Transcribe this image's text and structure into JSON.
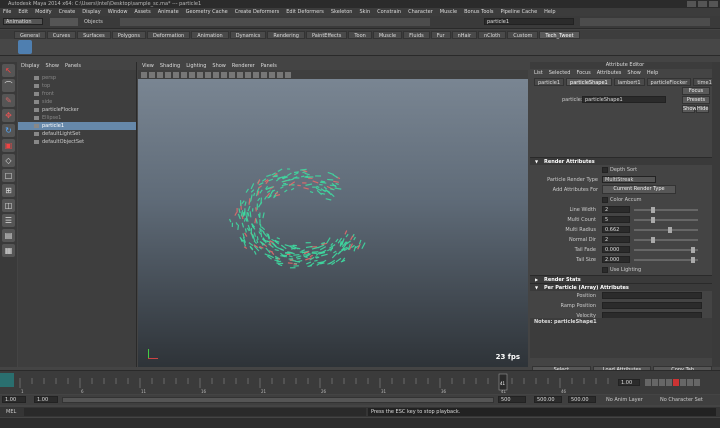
{
  "window": {
    "title": "Autodesk Maya 2014 x64: C:\\Users\\Intel\\Desktop\\sample_sc.ma* --- particle1"
  },
  "menubar": [
    "File",
    "Edit",
    "Modify",
    "Create",
    "Display",
    "Window",
    "Assets",
    "Animate",
    "Geometry Cache",
    "Create Deformers",
    "Edit Deformers",
    "Skeleton",
    "Skin",
    "Constrain",
    "Character",
    "Muscle",
    "Bonus Tools",
    "Pipeline Cache",
    "Help"
  ],
  "status": {
    "mode": "Animation",
    "objects": "Objects",
    "search": "particle1"
  },
  "shelf_tabs": [
    "General",
    "Curves",
    "Surfaces",
    "Polygons",
    "Deformation",
    "Animation",
    "Dynamics",
    "Rendering",
    "PaintEffects",
    "Toon",
    "Muscle",
    "Fluids",
    "Fur",
    "nHair",
    "nCloth",
    "Custom",
    "Tech_Tweet"
  ],
  "shelf_active": "Tech_Tweet",
  "outliner": {
    "menu": [
      "Display",
      "Show",
      "Panels"
    ],
    "items": [
      {
        "label": "persp",
        "state": "dim"
      },
      {
        "label": "top",
        "state": "dim"
      },
      {
        "label": "front",
        "state": "dim"
      },
      {
        "label": "side",
        "state": "dim"
      },
      {
        "label": "particleFlocker",
        "state": "normal"
      },
      {
        "label": "Ellipse1",
        "state": "dim"
      },
      {
        "label": "particle1",
        "state": "selected"
      },
      {
        "label": "defaultLightSet",
        "state": "normal"
      },
      {
        "label": "defaultObjectSet",
        "state": "normal"
      }
    ]
  },
  "viewport": {
    "menu": [
      "View",
      "Shading",
      "Lighting",
      "Show",
      "Renderer",
      "Panels"
    ],
    "fps": "23 fps"
  },
  "attribute_editor": {
    "title": "Attribute Editor",
    "menu": [
      "List",
      "Selected",
      "Focus",
      "Attributes",
      "Show",
      "Help"
    ],
    "tabs": [
      "particle1",
      "particleShape1",
      "lambert1",
      "particleFlocker",
      "time1"
    ],
    "active_tab": "particleShape1",
    "node_label": "particle:",
    "node_value": "particleShape1",
    "buttons": [
      "Focus",
      "Presets",
      "Show",
      "Hide"
    ],
    "render_attributes": {
      "header": "Render Attributes",
      "depth_sort": "Depth Sort",
      "render_type_label": "Particle Render Type",
      "render_type_value": "MultiStreak",
      "add_attr_label": "Add Attributes For",
      "add_attr_button": "Current Render Type",
      "color_accum": "Color Accum",
      "line_width": {
        "label": "Line Width",
        "value": "2"
      },
      "multi_count": {
        "label": "Multi Count",
        "value": "5"
      },
      "multi_radius": {
        "label": "Multi Radius",
        "value": "0.662"
      },
      "normal_dir": {
        "label": "Normal Dir",
        "value": "2"
      },
      "tail_fade": {
        "label": "Tail Fade",
        "value": "0.000"
      },
      "tail_size": {
        "label": "Tail Size",
        "value": "2.000"
      },
      "use_lighting": "Use Lighting"
    },
    "sections": [
      "Render Stats",
      "Per Particle (Array) Attributes"
    ],
    "per_particle": [
      "Position",
      "Ramp Position",
      "Velocity",
      "Ramp Velocity"
    ],
    "notes_label": "Notes:",
    "notes_value": "particleShape1",
    "bottom_buttons": [
      "Select",
      "Load Attributes",
      "Copy Tab"
    ]
  },
  "time_slider": {
    "ticks": [
      "1",
      "2",
      "3",
      "4",
      "5",
      "6",
      "7",
      "8",
      "9",
      "10",
      "11",
      "12",
      "13",
      "14",
      "15",
      "16",
      "17",
      "18",
      "19",
      "20",
      "21",
      "22",
      "23",
      "24",
      "25",
      "26",
      "27",
      "28",
      "29",
      "30",
      "31",
      "32",
      "33",
      "34",
      "35",
      "36",
      "37",
      "38",
      "39",
      "40",
      "41",
      "42",
      "43",
      "44",
      "45",
      "46",
      "47",
      "48",
      "49",
      "50"
    ],
    "current": "41"
  },
  "range": {
    "start": "1.00",
    "start2": "1.00",
    "end": "500",
    "end2": "500.00",
    "end3": "500.00",
    "current": "1.00",
    "anim_layer": "No Anim Layer",
    "char_set": "No Character Set"
  },
  "cmdline": {
    "label": "MEL",
    "message": "Press the ESC key to stop playback."
  },
  "colors": {
    "particles": "#3fd9a0",
    "selection": "#6688aa"
  }
}
